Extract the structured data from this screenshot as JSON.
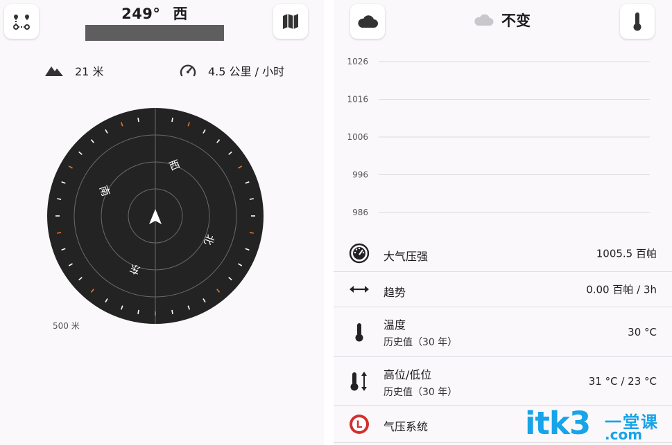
{
  "navigation": {
    "heading_degrees": "249°",
    "heading_direction": "西",
    "altitude": "21 米",
    "speed": "4.5 公里 / 小时",
    "compass_labels": {
      "north": "北",
      "south": "南",
      "east": "东",
      "west": "西"
    },
    "scale_label": "500 米"
  },
  "weather": {
    "trend_label": "不变",
    "chart_data": {
      "type": "line",
      "title": "",
      "xlabel": "",
      "ylabel": "",
      "y_ticks": [
        "1026",
        "1016",
        "1006",
        "996",
        "986"
      ],
      "ylim": [
        986,
        1026
      ],
      "grid": true,
      "series": []
    },
    "rows": [
      {
        "icon": "gauge-icon",
        "label": "大气压强",
        "value": "1005.5 百帕"
      },
      {
        "icon": "left-right-arrow-icon",
        "label": "趋势",
        "value": "0.00 百帕 / 3h"
      },
      {
        "icon": "thermometer-icon",
        "label": "温度",
        "sub": "历史值（30 年）",
        "value": "30 °C"
      },
      {
        "icon": "thermometer-high-low-icon",
        "label": "高位/低位",
        "sub": "历史值（30 年）",
        "value": "31 °C / 23 °C"
      },
      {
        "icon": "low-pressure-icon",
        "label": "气压系统",
        "icon_letter": "L"
      }
    ]
  },
  "watermark": {
    "brand": "itk3",
    "brand_cn": "一堂课",
    "brand_com": ".com"
  },
  "colors": {
    "accent_orange": "#e8762c",
    "watermark_blue": "#17a4e8",
    "compass_bg": "#222222",
    "low_pressure_red": "#d32f2f"
  }
}
